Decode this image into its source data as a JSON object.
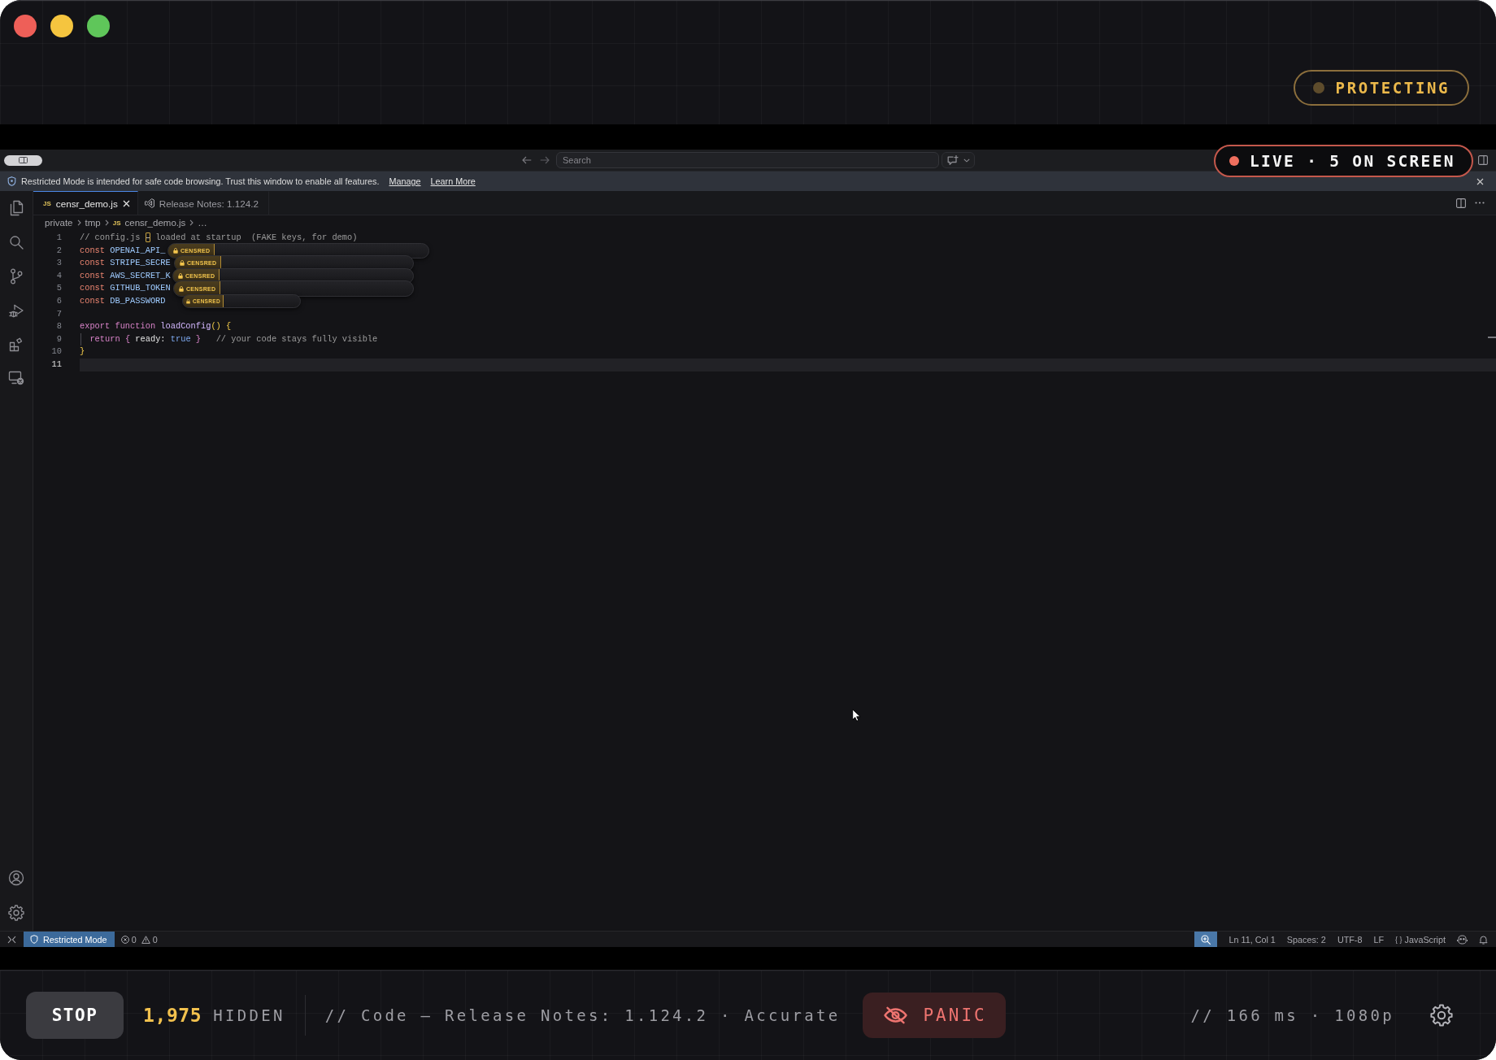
{
  "window": {
    "traffic_lights": [
      {
        "color": "#ee5f58"
      },
      {
        "color": "#f5c53f"
      },
      {
        "color": "#5fc65a"
      }
    ],
    "status_pill": {
      "label": "PROTECTING"
    },
    "live_badge": {
      "label": "LIVE · 5 ON SCREEN"
    }
  },
  "editor_window": {
    "search": {
      "placeholder": "Search"
    },
    "banner": {
      "message": "Restricted Mode is intended for safe code browsing. Trust this window to enable all features.",
      "links": [
        "Manage",
        "Learn More"
      ]
    },
    "tabs": [
      {
        "kind": "javascript",
        "icon_text": "JS",
        "label": "censr_demo.js",
        "selected": true
      },
      {
        "kind": "release-notes",
        "label": "Release Notes: 1.124.2",
        "selected": false
      }
    ],
    "breadcrumb": [
      {
        "label": "private"
      },
      {
        "label": "tmp"
      },
      {
        "label": "censr_demo.js",
        "icon_text": "JS"
      },
      {
        "label": "…"
      }
    ],
    "lines": [
      {
        "number": "1",
        "current": false,
        "tokens": [
          {
            "kind": "comment",
            "text": "// config.js "
          },
          {
            "kind": "unicode-highlight",
            "text": "–"
          },
          {
            "kind": "comment",
            "text": " loaded at startup  (FAKE keys, for demo)"
          }
        ]
      },
      {
        "number": "2",
        "current": false,
        "tokens": [
          {
            "kind": "storage",
            "text": "const "
          },
          {
            "kind": "variable",
            "text": "OPENAI_API_"
          }
        ],
        "redaction": {
          "label": "CENSRED",
          "kind": "wide"
        }
      },
      {
        "number": "3",
        "current": false,
        "tokens": [
          {
            "kind": "storage",
            "text": "const "
          },
          {
            "kind": "variable",
            "text": "STRIPE_SECRE"
          }
        ],
        "redaction": {
          "label": "CENSRED",
          "kind": "wide"
        }
      },
      {
        "number": "4",
        "current": false,
        "tokens": [
          {
            "kind": "storage",
            "text": "const "
          },
          {
            "kind": "variable",
            "text": "AWS_SECRET_K"
          }
        ],
        "redaction": {
          "label": "CENSRED",
          "kind": "wide"
        }
      },
      {
        "number": "5",
        "current": false,
        "tokens": [
          {
            "kind": "storage",
            "text": "const "
          },
          {
            "kind": "variable",
            "text": "GITHUB_TOKEN"
          }
        ],
        "redaction": {
          "label": "CENSRED",
          "kind": "wide"
        }
      },
      {
        "number": "6",
        "current": false,
        "tokens": [
          {
            "kind": "storage",
            "text": "const "
          },
          {
            "kind": "variable",
            "text": "DB_PASSWORD"
          }
        ],
        "redaction": {
          "label": "CENSRED",
          "kind": "compact"
        }
      },
      {
        "number": "7",
        "current": false
      },
      {
        "number": "8",
        "current": false,
        "tokens": [
          {
            "kind": "keyword",
            "text": "export "
          },
          {
            "kind": "keyword",
            "text": "function "
          },
          {
            "kind": "function",
            "text": "loadConfig"
          },
          {
            "kind": "bracket",
            "text": "() {"
          }
        ]
      },
      {
        "number": "9",
        "current": false,
        "indent_guide": true,
        "tokens": [
          {
            "kind": "keyword",
            "text": "  return "
          },
          {
            "kind": "brace",
            "text": "{"
          },
          {
            "kind": "property",
            "text": " ready: "
          },
          {
            "kind": "constant",
            "text": "true"
          },
          {
            "kind": "brace",
            "text": " }"
          },
          {
            "kind": "comment",
            "text": "   // your code stays fully visible"
          }
        ]
      },
      {
        "number": "10",
        "current": false,
        "tokens": [
          {
            "kind": "bracket",
            "text": "}"
          }
        ]
      },
      {
        "number": "11",
        "current": true
      }
    ],
    "status_bar": {
      "restricted_mode": "Restricted Mode",
      "errors": "0",
      "warnings": "0",
      "cursor_position": "Ln 11, Col 1",
      "indentation": "Spaces: 2",
      "encoding": "UTF-8",
      "line_ending": "LF",
      "language_icon": "{ }",
      "language": "JavaScript"
    }
  },
  "control_bar": {
    "stop": "STOP",
    "hidden_count": "1,975",
    "hidden_label": "HIDDEN",
    "context": "// Code — Release Notes: 1.124.2 · Accurate",
    "panic": "PANIC",
    "stats": "// 166 ms · 1080p"
  }
}
